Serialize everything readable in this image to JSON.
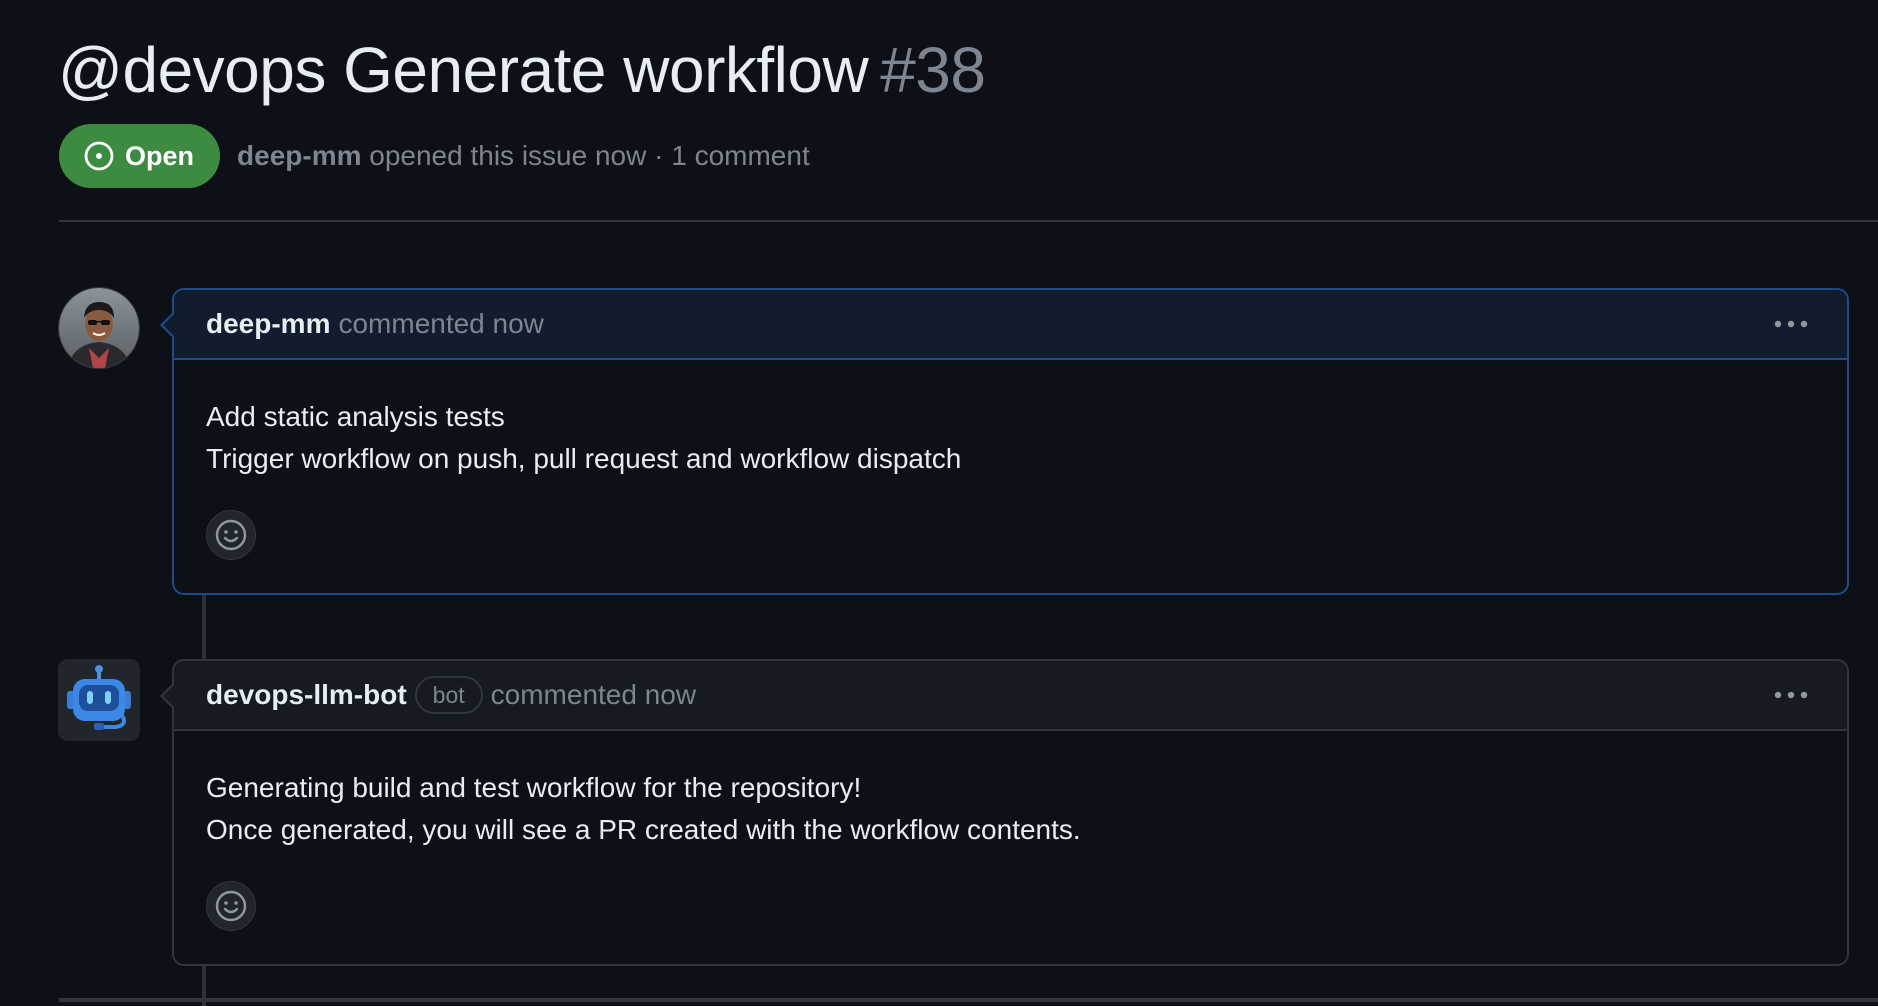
{
  "issue": {
    "title": "@devops Generate workflow",
    "number": "#38",
    "state_label": "Open",
    "state_color": "#3d8b40",
    "author": "deep-mm",
    "meta_text": "opened this issue now · 1 comment"
  },
  "comments": [
    {
      "author": "deep-mm",
      "action": "commented now",
      "avatar": "user-photo-avatar",
      "lines": [
        "Add static analysis tests",
        "Trigger workflow on push, pull request and workflow dispatch"
      ],
      "menu_icon": "kebab-horizontal-icon",
      "reaction_icon": "smiley-icon"
    },
    {
      "author": "devops-llm-bot",
      "badge": "bot",
      "action": "commented now",
      "avatar": "robot-avatar",
      "lines": [
        "Generating build and test workflow for the repository!",
        "Once generated, you will see a PR created with the workflow contents."
      ],
      "menu_icon": "kebab-horizontal-icon",
      "reaction_icon": "smiley-icon"
    }
  ],
  "colors": {
    "background": "#0d1117",
    "highlight_border": "#1f4a88",
    "muted_text": "#7d8590"
  }
}
